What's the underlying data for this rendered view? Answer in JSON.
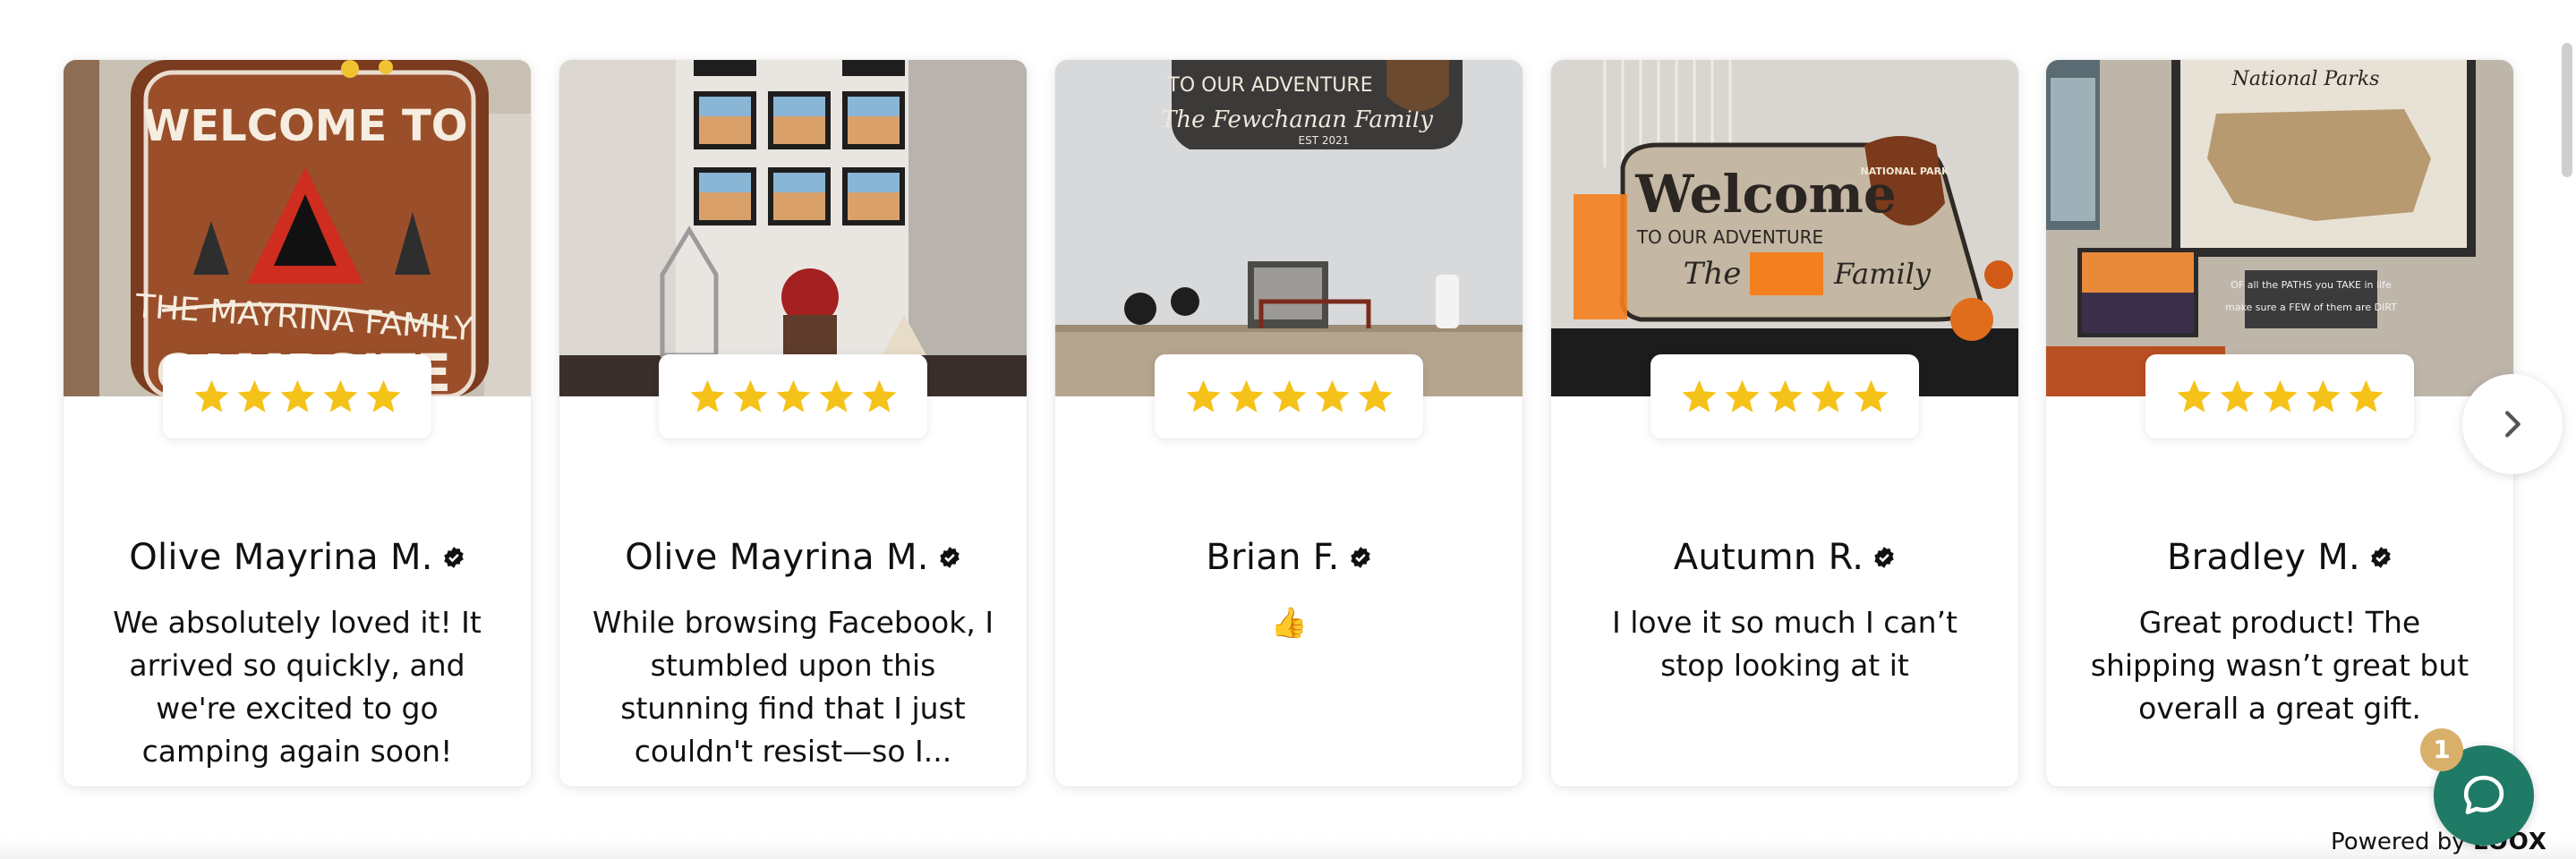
{
  "colors": {
    "star": "#f5c21a",
    "verified": "#111111",
    "chat_button": "#1f7a66",
    "chat_badge": "#d8b06a"
  },
  "reviews": [
    {
      "reviewer": "Olive Mayrina M.",
      "rating": 5,
      "text": "We absolutely loved it! It arrived so quickly, and we're excited to go camping again soon!",
      "photo": {
        "sign_lines": [
          "WELCOME TO",
          "THE MAYRINA FAMILY",
          "CAMPSITE"
        ]
      }
    },
    {
      "reviewer": "Olive Mayrina M.",
      "rating": 5,
      "text": "While browsing Facebook, I stumbled upon this stunning find that I just couldn't resist—so I...",
      "photo": {
        "sign_lines": []
      }
    },
    {
      "reviewer": "Brian F.",
      "rating": 5,
      "text": "👍",
      "photo": {
        "sign_lines": [
          "TO OUR ADVENTURE",
          "The Fewchanan Family",
          "EST 2021"
        ]
      }
    },
    {
      "reviewer": "Autumn R.",
      "rating": 5,
      "text": "I love it so much I can’t stop looking at it",
      "photo": {
        "sign_lines": [
          "Welcome",
          "TO OUR ADVENTURE",
          "The",
          "Family",
          "NATIONAL PARK"
        ]
      }
    },
    {
      "reviewer": "Bradley M.",
      "rating": 5,
      "text": "Great product! The shipping wasn’t great but overall a great gift.",
      "photo": {
        "sign_lines": [
          "National Parks",
          "OF all the PATHS you TAKE in life",
          "make sure a FEW of them are DIRT"
        ]
      }
    }
  ],
  "carousel": {
    "next_icon": "chevron-right-icon"
  },
  "footer": {
    "powered_prefix": "Powered by",
    "powered_brand": "LOOX"
  },
  "chat": {
    "icon": "chat-bubble-icon",
    "badge_count": "1"
  }
}
